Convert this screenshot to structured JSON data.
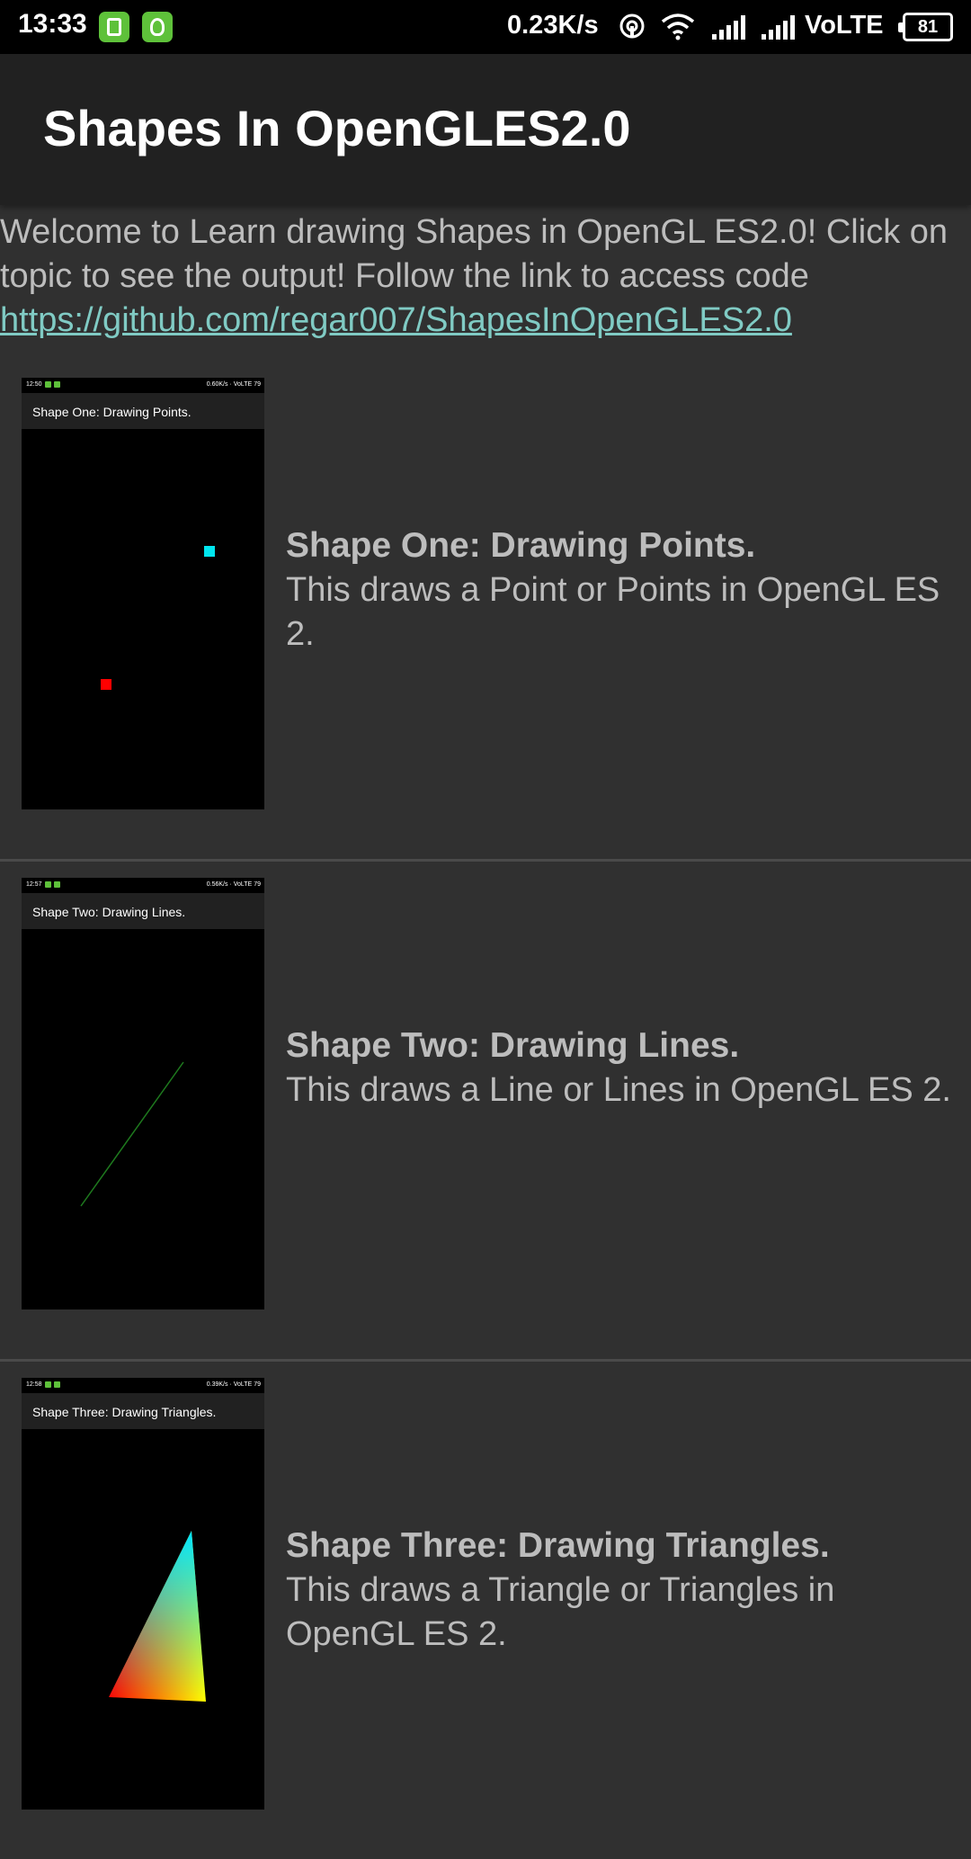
{
  "status_bar": {
    "time": "13:33",
    "speed": "0.23K/s",
    "network": "VoLTE",
    "battery": "81"
  },
  "app_bar": {
    "title": "Shapes In OpenGLES2.0"
  },
  "intro": {
    "text": "Welcome to Learn drawing Shapes in OpenGL ES2.0! Click on topic to see the output! Follow the link to access code",
    "link": "https://github.com/regar007/ShapesInOpenGLES2.0"
  },
  "items": [
    {
      "heading": "Shape One: Drawing Points.",
      "description": "This draws a Point or Points in OpenGL ES 2.",
      "thumb_time": "12:50",
      "thumb_speed": "0.60K/s",
      "thumb_network": "VoLTE",
      "thumb_battery": "79",
      "thumb_title": "Shape One: Drawing Points."
    },
    {
      "heading": "Shape Two: Drawing Lines.",
      "description": "This draws a Line or Lines in OpenGL ES 2.",
      "thumb_time": "12:57",
      "thumb_speed": "0.56K/s",
      "thumb_network": "VoLTE",
      "thumb_battery": "79",
      "thumb_title": "Shape Two: Drawing Lines."
    },
    {
      "heading": "Shape Three: Drawing Triangles.",
      "description": "This draws a Triangle or Triangles in OpenGL ES 2.",
      "thumb_time": "12:58",
      "thumb_speed": "0.39K/s",
      "thumb_network": "VoLTE",
      "thumb_battery": "79",
      "thumb_title": "Shape Three: Drawing Triangles."
    }
  ],
  "colors": {
    "background": "#303030",
    "app_bar": "#212121",
    "link": "#80cbc4",
    "point_cyan": "#00e5ee",
    "point_red": "#ff0000",
    "line_green": "#1e7a1e"
  }
}
